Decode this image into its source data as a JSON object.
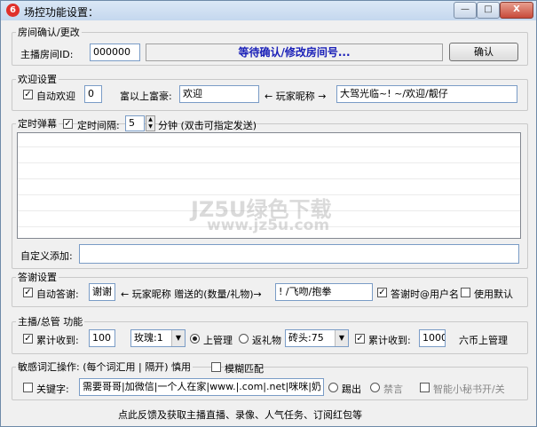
{
  "window": {
    "title": "场控功能设置：",
    "minimize": "—",
    "maximize": "□",
    "close": "X"
  },
  "room": {
    "legend": "房间确认/更改",
    "label": "主播房间ID:",
    "id_value": "000000",
    "status": "等待确认/修改房间号...",
    "confirm": "确认"
  },
  "welcome": {
    "legend": "欢迎设置",
    "auto_label": "自动欢迎",
    "auto_checked": true,
    "count": "0",
    "rich_label": "富以上富豪:",
    "rich_value": "欢迎",
    "arrow_left": "← 玩家昵称 →",
    "suffix_value": "大驾光临~! ~/欢迎/靓仔"
  },
  "timed": {
    "legend_text": "定时弹幕",
    "legend_checked": true,
    "interval_label": "定时间隔:",
    "interval_checked": true,
    "interval_value": "5",
    "unit": "分钟 (双击可指定发送)",
    "custom_label": "自定义添加:",
    "custom_value": ""
  },
  "thanks": {
    "legend": "答谢设置",
    "auto_label": "自动答谢:",
    "auto_checked": true,
    "prefix_value": "谢谢",
    "middle_text": "← 玩家昵称 赠送的(数量/礼物)→",
    "suffix_value": "! /飞吻/抱拳",
    "username_label": "答谢时@用户名",
    "username_checked": true,
    "default_label": "使用默认",
    "default_checked": false
  },
  "admin": {
    "legend": "主播/总管 功能",
    "receive_label": "累计收到:",
    "receive_checked": true,
    "receive_value": "100",
    "gift_select": "玫瑰:1",
    "manage_label": "上管理",
    "return_label": "返礼物",
    "gift2_select": "砖头:75",
    "receive2_label": "累计收到:",
    "receive2_checked": true,
    "receive2_value": "1000",
    "six_label": "六币上管理"
  },
  "sensitive": {
    "legend": "敏感词汇操作: (每个词汇用 | 隔开) 慎用",
    "fuzzy_label": "模糊匹配",
    "fuzzy_checked": false,
    "keyword_label": "关键字:",
    "keyword_checked": false,
    "keyword_value": "需要哥哥|加微信|一个人在家|www.|.com|.net|咪咪|奶",
    "kick_label": "踢出",
    "other_label": "禁言",
    "extra_label": "智能小秘书开/关"
  },
  "footer": "点此反馈及获取主播直播、录像、人气任务、订阅红包等",
  "watermark": {
    "big": "JZ5U绿色下载",
    "small": "www.jz5u.com"
  }
}
